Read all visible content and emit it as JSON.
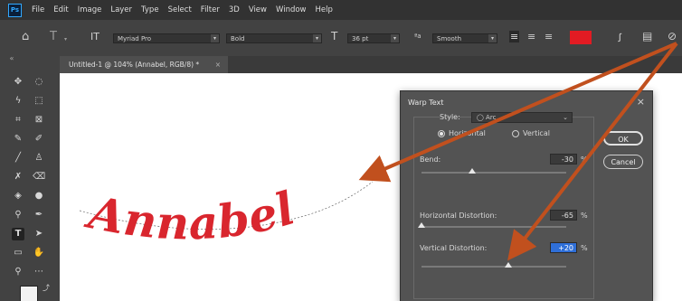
{
  "menubar": {
    "logo": "Ps",
    "items": [
      "File",
      "Edit",
      "Image",
      "Layer",
      "Type",
      "Select",
      "Filter",
      "3D",
      "View",
      "Window",
      "Help"
    ]
  },
  "options": {
    "font_family": "Myriad Pro",
    "font_style": "Bold",
    "font_size": "36 pt",
    "aa_label": "ªa",
    "antialias": "Smooth",
    "text_color": "#e21b23"
  },
  "document": {
    "tab_title": "Untitled-1 @ 104% (Annabel, RGB/8) *",
    "close_glyph": "×",
    "canvas_text": "Annabel",
    "text_color": "#d9262e"
  },
  "toolbar": {
    "collapse": "«"
  },
  "dialog": {
    "title": "Warp Text",
    "close": "×",
    "style_label": "Style:",
    "style_value": "◯ Arc",
    "orientation_horizontal": "Horizontal",
    "orientation_vertical": "Vertical",
    "selected_orientation": "Horizontal",
    "bend_label": "Bend:",
    "bend_value": "-30",
    "hdist_label": "Horizontal Distortion:",
    "hdist_value": "-65",
    "vdist_label": "Vertical Distortion:",
    "vdist_value": "+20",
    "percent": "%",
    "ok": "OK",
    "cancel": "Cancel",
    "sliders": {
      "bend": -30,
      "horizontal": -65,
      "vertical": 20
    }
  },
  "annotation_color": "#c1501e"
}
